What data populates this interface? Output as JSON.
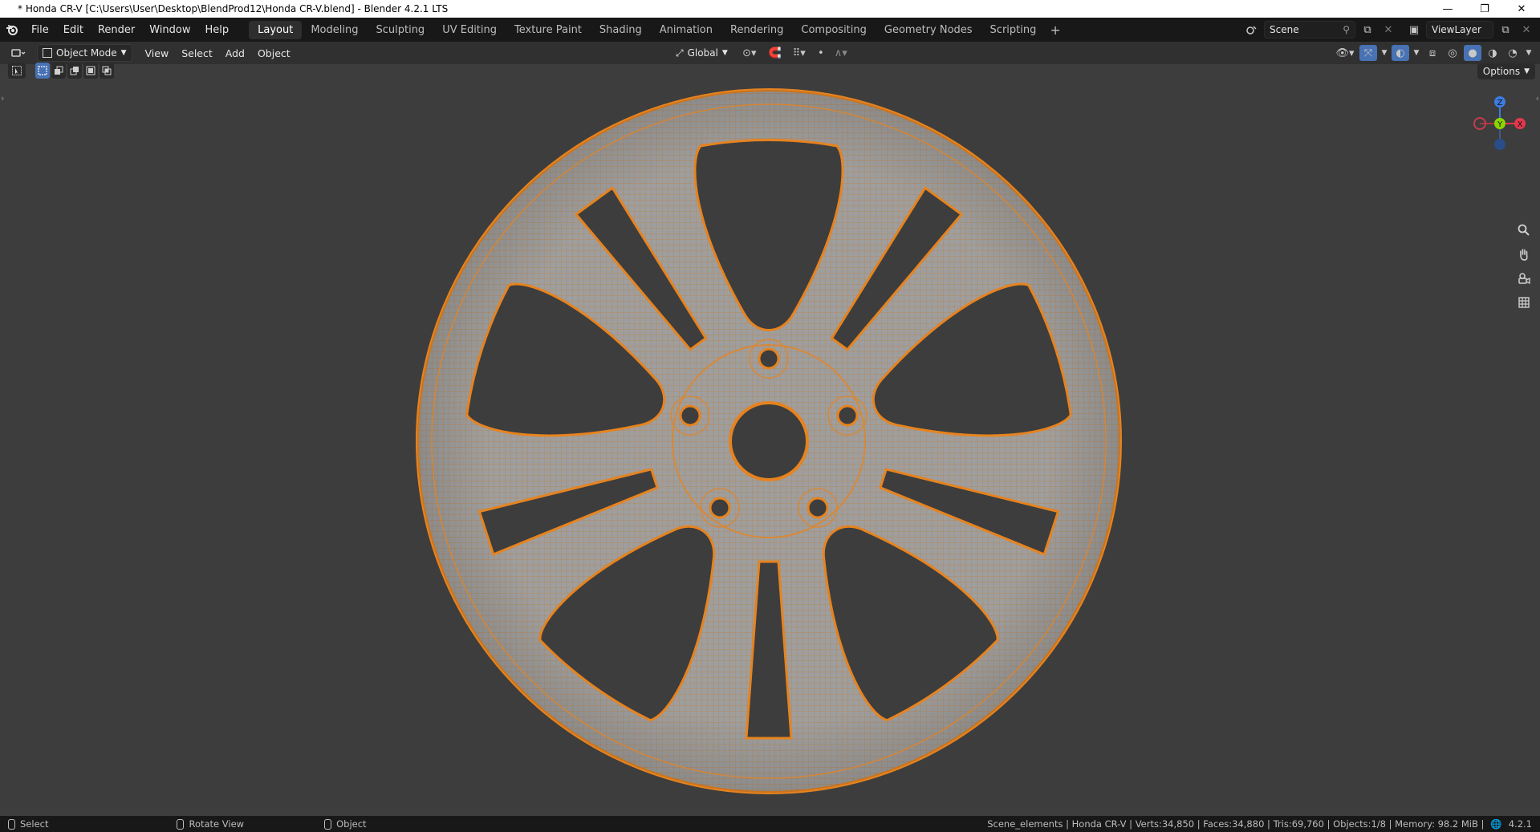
{
  "window": {
    "title": "* Honda CR-V [C:\\Users\\User\\Desktop\\BlendProd12\\Honda CR-V.blend] - Blender 4.2.1 LTS",
    "minimize": "—",
    "restore": "❐",
    "close": "✕"
  },
  "menu": [
    "File",
    "Edit",
    "Render",
    "Window",
    "Help"
  ],
  "workspaces": [
    {
      "label": "Layout",
      "active": true
    },
    {
      "label": "Modeling"
    },
    {
      "label": "Sculpting"
    },
    {
      "label": "UV Editing"
    },
    {
      "label": "Texture Paint"
    },
    {
      "label": "Shading"
    },
    {
      "label": "Animation"
    },
    {
      "label": "Rendering"
    },
    {
      "label": "Compositing"
    },
    {
      "label": "Geometry Nodes"
    },
    {
      "label": "Scripting"
    }
  ],
  "add_workspace": "+",
  "scene": {
    "name": "Scene",
    "view_layer": "ViewLayer"
  },
  "viewport_header": {
    "mode": "Object Mode",
    "menus": [
      "View",
      "Select",
      "Add",
      "Object"
    ],
    "orientation": "Global"
  },
  "options_label": "Options",
  "status": {
    "left": [
      "Select",
      "Rotate View",
      "Object"
    ],
    "scene_info": "Scene_elements | Honda CR-V | Verts:34,850 | Faces:34,880 | Tris:69,760 | Objects:1/8 | Memory: 98.2 MiB |",
    "version": "4.2.1"
  },
  "gizmo": {
    "z": "Z",
    "y": "Y",
    "x": "X"
  },
  "colors": {
    "accent": "#e6831f",
    "wheel_fill": "#9e9e9e",
    "background": "#3d3d3d",
    "topbar": "#181818",
    "header": "#303030"
  },
  "icons": [
    "blender-logo-icon",
    "editor-type-icon",
    "object-mode-icon",
    "orientation-icon",
    "pivot-icon",
    "snap-icon",
    "proportional-icon",
    "visibility-icon",
    "gizmo-icon",
    "overlay-icon",
    "xray-icon",
    "shading-wireframe-icon",
    "shading-solid-icon",
    "shading-material-icon",
    "shading-rendered-icon",
    "zoom-icon",
    "pan-icon",
    "camera-icon",
    "grid-icon"
  ]
}
